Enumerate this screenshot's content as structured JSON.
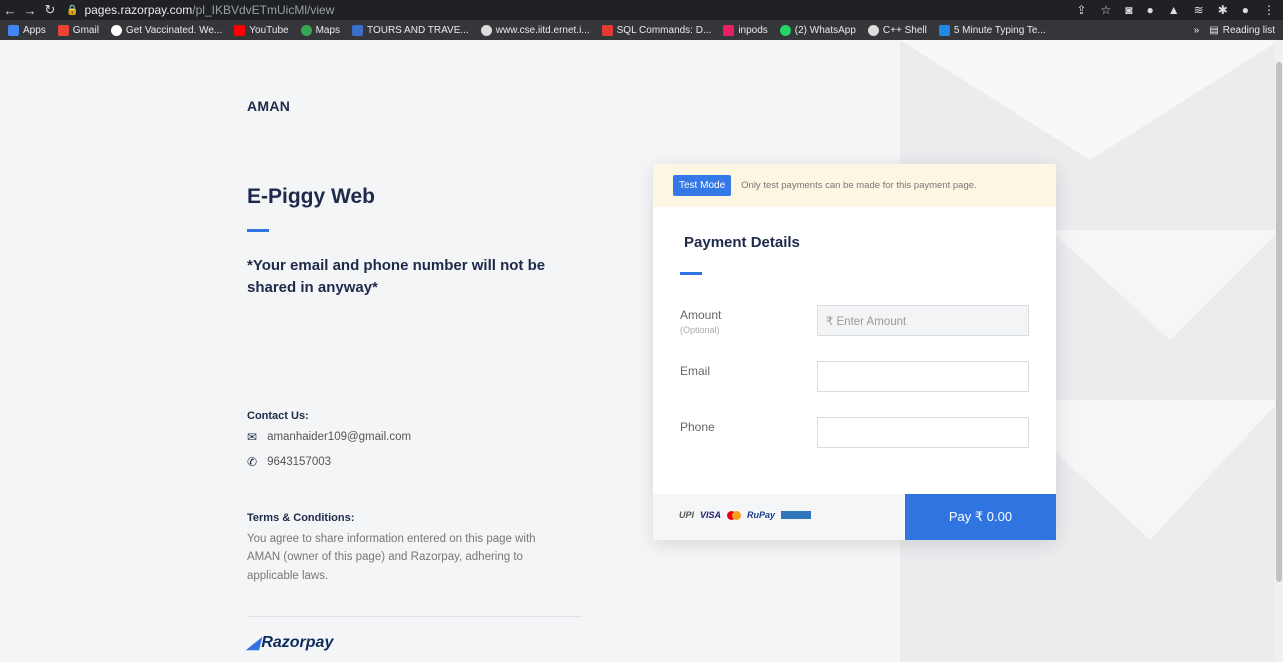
{
  "browser": {
    "url_host": "pages.razorpay.com",
    "url_path": "/pl_IKBVdvETmUicMl/view",
    "bookmarks": [
      "Apps",
      "Gmail",
      "Get Vaccinated. We...",
      "YouTube",
      "Maps",
      "TOURS AND TRAVE...",
      "www.cse.iitd.ernet.i...",
      "SQL Commands: D...",
      "inpods",
      "(2) WhatsApp",
      "C++ Shell",
      "5 Minute Typing Te..."
    ],
    "reading_list": "Reading list",
    "more": "»"
  },
  "merchant": "AMAN",
  "page_title": "E-Piggy Web",
  "description": "*Your email and phone number will not be shared in anyway*",
  "contact": {
    "heading": "Contact Us:",
    "email": "amanhaider109@gmail.com",
    "phone": "9643157003"
  },
  "terms": {
    "heading": "Terms & Conditions:",
    "text": "You agree to share information entered on this page with AMAN (owner of this page) and Razorpay, adhering to applicable laws."
  },
  "brand": "Razorpay",
  "card": {
    "test_badge": "Test Mode",
    "test_text": "Only test payments can be made for this payment page.",
    "title": "Payment Details",
    "amount_label": "Amount",
    "amount_sub": "(Optional)",
    "amount_placeholder": "₹ Enter Amount",
    "email_label": "Email",
    "email_value": "",
    "phone_label": "Phone",
    "phone_value": "",
    "pay_button": "Pay ₹ 0.00",
    "logos": [
      "UPI",
      "VISA",
      "RuPay"
    ]
  },
  "colors": {
    "accent": "#2f74e0",
    "heading": "#1e2a4a",
    "test_bg": "#fdf6e3"
  }
}
